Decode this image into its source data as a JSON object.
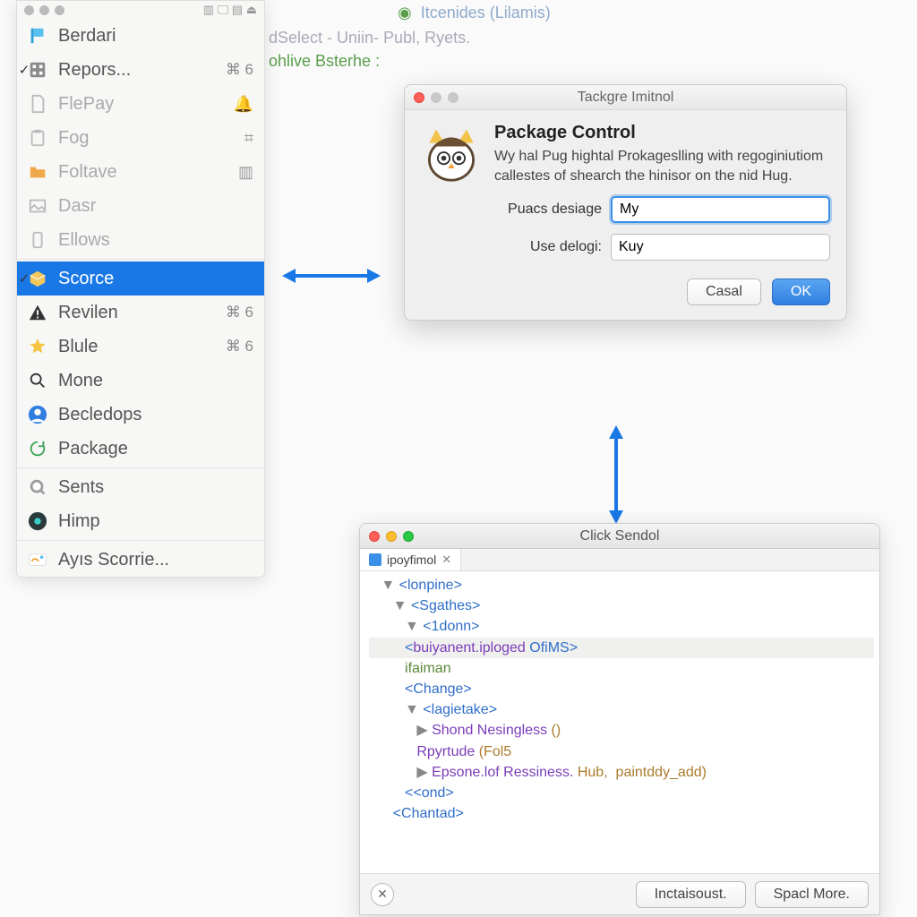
{
  "background": {
    "line1_marker": "◉",
    "line1": "Itcenides  (Lilamis)",
    "line2": "dSelect - Uniin- Publ,  Ryets.",
    "line3": "ohlive  Bsterhe :"
  },
  "sidebar": {
    "items": [
      {
        "label": "Berdari"
      },
      {
        "label": "Repors...",
        "shortcut": "⌘ 6",
        "checked": true
      },
      {
        "label": "FlePay"
      },
      {
        "label": "Fog"
      },
      {
        "label": "Foltave"
      },
      {
        "label": "Dasr"
      },
      {
        "label": "Ellows"
      },
      {
        "label": "Scorce",
        "selected": true,
        "checked": true
      },
      {
        "label": "Revilen",
        "shortcut": "⌘ 6"
      },
      {
        "label": "Blule",
        "shortcut": "⌘ 6"
      },
      {
        "label": "Mone"
      },
      {
        "label": "Becledops"
      },
      {
        "label": "Package"
      },
      {
        "label": "Sents"
      },
      {
        "label": "Himp"
      },
      {
        "label": "Ayıs Scorrie..."
      }
    ]
  },
  "dialog": {
    "titlebar": "Tackgre Imitnol",
    "heading": "Package Control",
    "desc": "Wy hal Pug hightal Prokageslling with regoginiutiom callestes of shearch the hinisor on the nid Hug.",
    "field1_label": "Puacs desiage",
    "field1_value": "My",
    "field2_label": "Use delogi:",
    "field2_value": "Kuy",
    "cancel": "Casal",
    "ok": "OK"
  },
  "win2": {
    "title": "Click Sendol",
    "tab_label": "ipoyfimol",
    "footer_btn1": "Inctaisoust.",
    "footer_btn2": "Spacl More.",
    "tree": [
      {
        "indent": 1,
        "chev": "▼",
        "tag": "lonpine"
      },
      {
        "indent": 2,
        "chev": "▼",
        "tag": "Sgathes"
      },
      {
        "indent": 3,
        "chev": "▼",
        "tag": "1donn"
      },
      {
        "indent": 3,
        "hl": true,
        "raw_pre": "<",
        "name": "buiyanent.iploged",
        "after": " OfiMS",
        "raw_post": ">"
      },
      {
        "indent": 3,
        "text": "ifaiman"
      },
      {
        "indent": 3,
        "tag_open": "Change"
      },
      {
        "indent": 3,
        "chev": "▼",
        "tag": "lagietake"
      },
      {
        "indent": 4,
        "chev": "▶",
        "name2": "Shond Nesingless",
        "paren": " ()"
      },
      {
        "indent": 4,
        "name2": "Rpyrtude",
        "paren": " (Fol5"
      },
      {
        "indent": 4,
        "chev": "▶",
        "name2": "Epsone.lof Ressiness.",
        "rest": " Hub,  paintddy_add)"
      },
      {
        "indent": 3,
        "close2": "ond"
      },
      {
        "indent": 2,
        "tag_close": "Chantad"
      }
    ]
  }
}
